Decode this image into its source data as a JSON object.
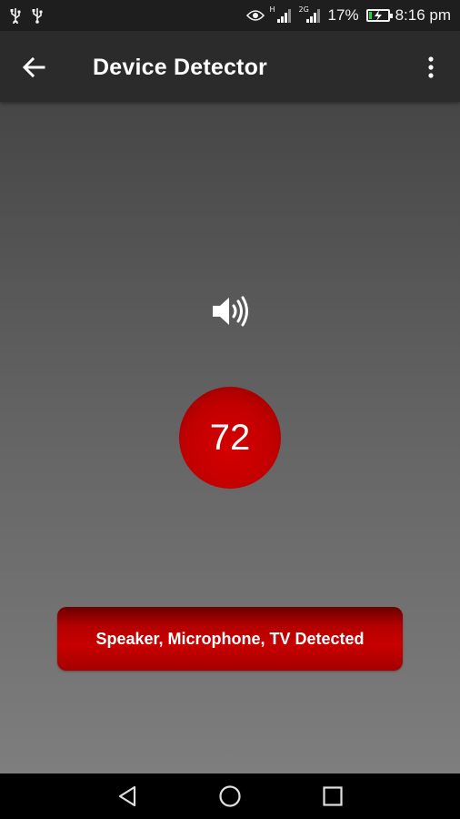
{
  "status_bar": {
    "left_icons": [
      "usb-icon",
      "usb-icon"
    ],
    "right_icons": [
      "eye-icon",
      "signal-icon",
      "signal-icon",
      "battery-icon"
    ],
    "signal_1_tag": "H",
    "signal_2_tag": "2G",
    "battery_percent": "17%",
    "battery_level": 0.17,
    "time": "8:16 pm"
  },
  "app_bar": {
    "title": "Device Detector",
    "back_icon": "arrow-left-icon",
    "menu_icon": "overflow-menu-icon"
  },
  "detector": {
    "icon": "speaker-icon",
    "level": "72",
    "result": "Speaker, Microphone, TV Detected"
  },
  "colors": {
    "accent_red": "#c80000",
    "app_bar": "#2b2b2b",
    "status_bar": "#1e1e1e",
    "battery_green": "#2ecc40"
  },
  "nav_bar": {
    "icons": [
      "back-triangle-icon",
      "home-circle-icon",
      "recents-square-icon"
    ]
  }
}
